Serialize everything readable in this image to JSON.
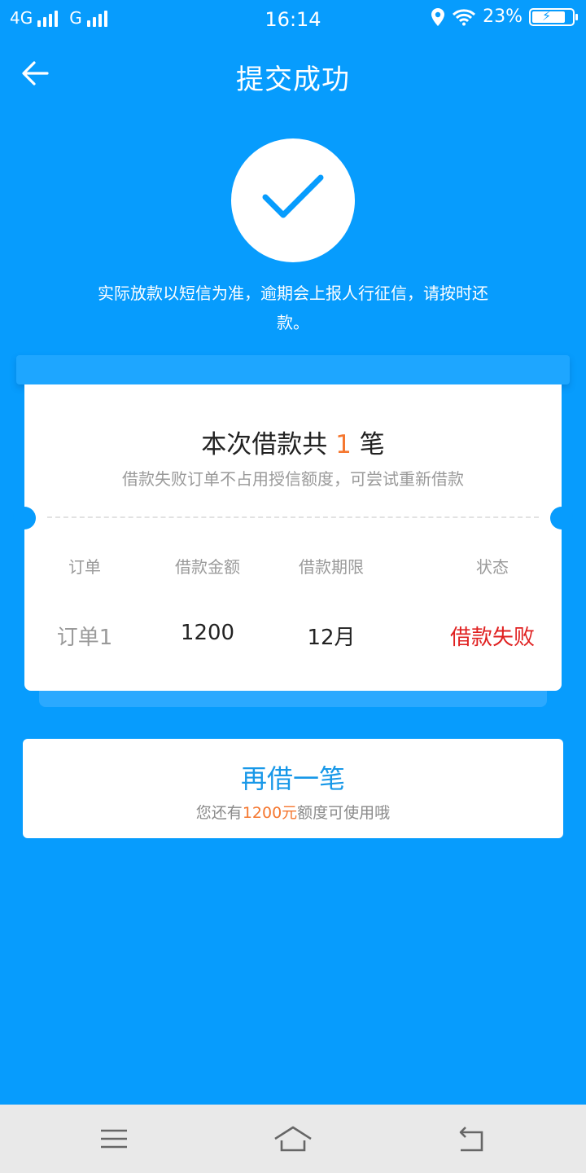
{
  "status_bar": {
    "network1": "4G",
    "network2": "G",
    "time": "16:14",
    "battery": "23%"
  },
  "header": {
    "title": "提交成功",
    "back_icon": "arrow-left-icon"
  },
  "success": {
    "icon": "checkmark-icon",
    "notice": "实际放款以短信为准，逾期会上报人行征信，请按时还款。"
  },
  "card": {
    "title_prefix": "本次借款共",
    "title_count": "1",
    "title_suffix": "笔",
    "subtitle": "借款失败订单不占用授信额度，可尝试重新借款",
    "columns": [
      "订单",
      "借款金额",
      "借款期限",
      "状态"
    ],
    "rows": [
      {
        "order": "订单1",
        "amount": "1200",
        "term": "12月",
        "status": "借款失败"
      }
    ]
  },
  "borrow_again": {
    "label": "再借一笔",
    "sub_prefix": "您还有",
    "sub_amount": "1200元",
    "sub_suffix": "额度可使用哦"
  },
  "nav_bar": {
    "icons": [
      "menu-icon",
      "home-icon",
      "back-icon"
    ]
  },
  "colors": {
    "background": "#079cfd",
    "accent_orange": "#f5772f",
    "fail_red": "#e02020",
    "link_blue": "#1898e8"
  }
}
